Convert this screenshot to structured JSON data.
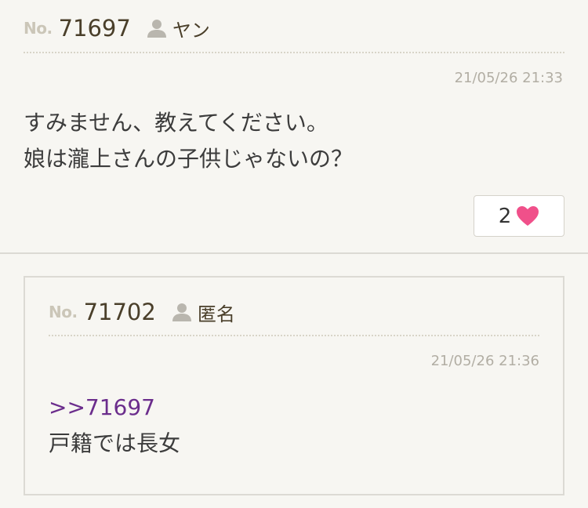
{
  "post": {
    "no_label": "No.",
    "number": "71697",
    "user_icon": "user-icon",
    "user_name": "ヤン",
    "date": "21/05/26 21:33",
    "body": [
      "すみません、教えてください。",
      "娘は瀧上さんの子供じゃないの？"
    ],
    "like_count": "2",
    "like_icon": "heart-icon",
    "like_color": "#f0508a"
  },
  "reply": {
    "no_label": "No.",
    "number": "71702",
    "user_icon": "user-icon",
    "user_name": "匿名",
    "date": "21/05/26 21:36",
    "anchor": ">>71697",
    "body": "戸籍では長女",
    "anchor_color": "#6b2d8c"
  }
}
